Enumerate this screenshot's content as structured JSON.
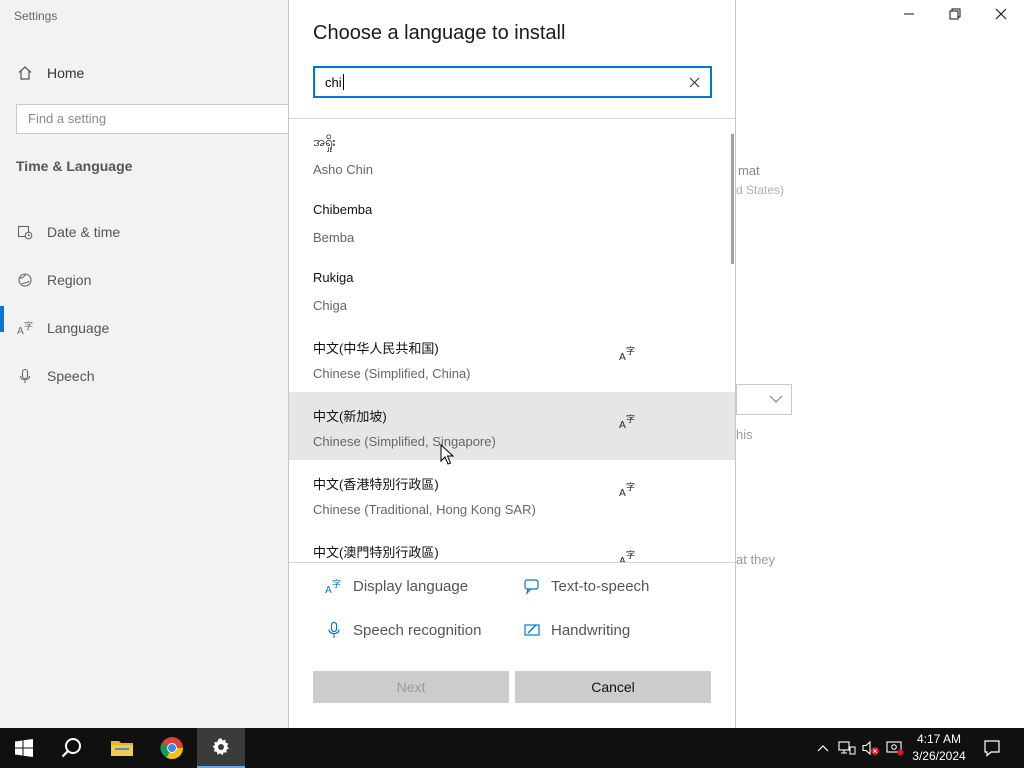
{
  "settings": {
    "window_title": "Settings",
    "home_label": "Home",
    "search_placeholder": "Find a setting",
    "section_title": "Time & Language",
    "nav": [
      {
        "label": "Date & time",
        "icon": "calendar-clock-icon"
      },
      {
        "label": "Region",
        "icon": "globe-icon"
      },
      {
        "label": "Language",
        "icon": "language-icon"
      },
      {
        "label": "Speech",
        "icon": "microphone-icon"
      }
    ],
    "active_nav": "Language",
    "background_fragments": [
      "mat",
      "d States)",
      "his",
      "at they"
    ]
  },
  "dialog": {
    "title": "Choose a language to install",
    "search_value": "chi",
    "languages": [
      {
        "native": "အရှိုး",
        "english": "Asho Chin",
        "display_language": false
      },
      {
        "native": "Chibemba",
        "english": "Bemba",
        "display_language": false
      },
      {
        "native": "Rukiga",
        "english": "Chiga",
        "display_language": false
      },
      {
        "native": "中文(中华人民共和国)",
        "english": "Chinese (Simplified, China)",
        "display_language": true
      },
      {
        "native": "中文(新加坡)",
        "english": "Chinese (Simplified, Singapore)",
        "display_language": true
      },
      {
        "native": "中文(香港特別行政區)",
        "english": "Chinese (Traditional, Hong Kong SAR)",
        "display_language": true
      },
      {
        "native": "中文(澳門特別行政區)",
        "english": "",
        "display_language": true
      }
    ],
    "hovered_index": 4,
    "features": {
      "display_language": "Display language",
      "text_to_speech": "Text-to-speech",
      "speech_recognition": "Speech recognition",
      "handwriting": "Handwriting"
    },
    "next_label": "Next",
    "cancel_label": "Cancel"
  },
  "taskbar": {
    "time": "4:17 AM",
    "date": "3/26/2024",
    "apps": [
      "start-icon",
      "search-icon",
      "file-explorer-icon",
      "chrome-icon",
      "settings-icon"
    ],
    "active_app": "settings-icon"
  },
  "colors": {
    "accent": "#0078d4",
    "hover_row": "#e6e6e6",
    "taskbar": "#101010"
  }
}
